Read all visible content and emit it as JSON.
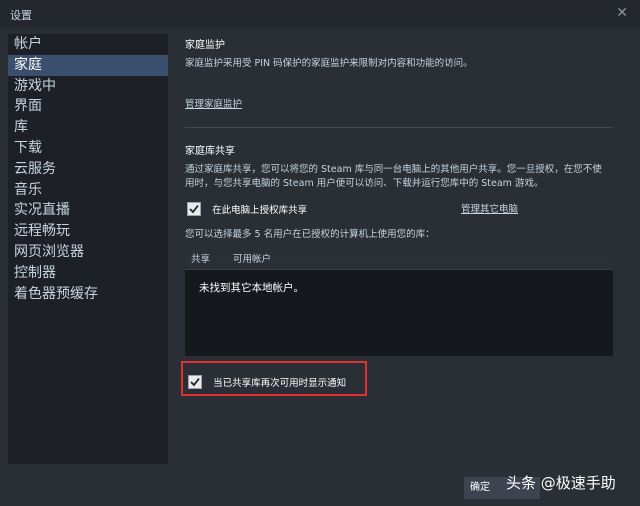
{
  "window": {
    "title": "设置"
  },
  "sidebar": {
    "items": [
      {
        "label": "帐户"
      },
      {
        "label": "家庭"
      },
      {
        "label": "游戏中"
      },
      {
        "label": "界面"
      },
      {
        "label": "库"
      },
      {
        "label": "下载"
      },
      {
        "label": "云服务"
      },
      {
        "label": "音乐"
      },
      {
        "label": "实况直播"
      },
      {
        "label": "远程畅玩"
      },
      {
        "label": "网页浏览器"
      },
      {
        "label": "控制器"
      },
      {
        "label": "着色器预缓存"
      }
    ],
    "active_index": 1
  },
  "family_monitor": {
    "heading": "家庭监护",
    "description": "家庭监护采用受 PIN 码保护的家庭监护来限制对内容和功能的访问。",
    "manage_link": "管理家庭监护"
  },
  "library_sharing": {
    "heading": "家庭库共享",
    "description_line1": "通过家庭库共享，您可以将您的 Steam 库与同一台电脑上的其他用户共享。您一旦授权，在您不使",
    "description_line2": "用时，与您共享电脑的 Steam 用户便可以访问、下载并运行您库中的 Steam 游戏。",
    "authorize_checkbox_label": "在此电脑上授权库共享",
    "authorize_checked": true,
    "manage_devices_link": "管理其它电脑",
    "choose_text": "您可以选择最多 5 名用户在已授权的计算机上使用您的库：",
    "table": {
      "col_share": "共享",
      "col_accounts": "可用帐户",
      "empty_message": "未找到其它本地帐户。"
    },
    "notify_checkbox_label": "当已共享库再次可用时显示通知",
    "notify_checked": true
  },
  "footer": {
    "ok_label": "确定",
    "watermark": "头条 @极速手助"
  },
  "colors": {
    "highlight_box": "#e03030",
    "sidebar_active": "#3a4f6e"
  }
}
